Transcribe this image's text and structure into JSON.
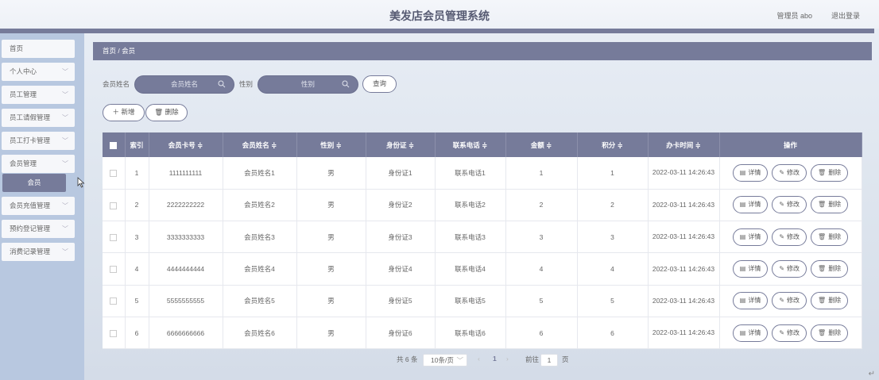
{
  "header": {
    "title": "美发店会员管理系统",
    "user": "管理员 abo",
    "logout": "退出登录"
  },
  "sidebar": {
    "items": [
      {
        "label": "首页",
        "has_arrow": false
      },
      {
        "label": "个人中心",
        "has_arrow": true
      },
      {
        "label": "员工管理",
        "has_arrow": true
      },
      {
        "label": "员工请假管理",
        "has_arrow": true
      },
      {
        "label": "员工打卡管理",
        "has_arrow": true
      },
      {
        "label": "会员管理",
        "has_arrow": true
      },
      {
        "label": "会员充值管理",
        "has_arrow": true
      },
      {
        "label": "预约登记管理",
        "has_arrow": true
      },
      {
        "label": "消费记录管理",
        "has_arrow": true
      }
    ],
    "active_sub": "会员"
  },
  "breadcrumb": "首页 / 会员",
  "search": {
    "name_label": "会员姓名",
    "name_placeholder": "会员姓名",
    "gender_label": "性别",
    "gender_placeholder": "性别",
    "query_button": "查询"
  },
  "actions": {
    "add": "新增",
    "delete": "删除"
  },
  "table": {
    "columns": [
      "索引",
      "会员卡号 ≑",
      "会员姓名 ≑",
      "性别 ≑",
      "身份证 ≑",
      "联系电话 ≑",
      "金额 ≑",
      "积分 ≑",
      "办卡时间 ≑",
      "操作"
    ],
    "rows": [
      {
        "index": "1",
        "card": "1111111111",
        "name": "会员姓名1",
        "gender": "男",
        "id_card": "身份证1",
        "phone": "联系电话1",
        "amount": "1",
        "points": "1",
        "time": "2022-03-11 14:26:43"
      },
      {
        "index": "2",
        "card": "2222222222",
        "name": "会员姓名2",
        "gender": "男",
        "id_card": "身份证2",
        "phone": "联系电话2",
        "amount": "2",
        "points": "2",
        "time": "2022-03-11 14:26:43"
      },
      {
        "index": "3",
        "card": "3333333333",
        "name": "会员姓名3",
        "gender": "男",
        "id_card": "身份证3",
        "phone": "联系电话3",
        "amount": "3",
        "points": "3",
        "time": "2022-03-11 14:26:43"
      },
      {
        "index": "4",
        "card": "4444444444",
        "name": "会员姓名4",
        "gender": "男",
        "id_card": "身份证4",
        "phone": "联系电话4",
        "amount": "4",
        "points": "4",
        "time": "2022-03-11 14:26:43"
      },
      {
        "index": "5",
        "card": "5555555555",
        "name": "会员姓名5",
        "gender": "男",
        "id_card": "身份证5",
        "phone": "联系电话5",
        "amount": "5",
        "points": "5",
        "time": "2022-03-11 14:26:43"
      },
      {
        "index": "6",
        "card": "6666666666",
        "name": "会员姓名6",
        "gender": "男",
        "id_card": "身份证6",
        "phone": "联系电话6",
        "amount": "6",
        "points": "6",
        "time": "2022-03-11 14:26:43"
      }
    ],
    "row_buttons": {
      "detail": "详情",
      "edit": "修改",
      "delete": "删除"
    }
  },
  "pagination": {
    "total": "共 6 条",
    "page_size": "10条/页",
    "current_page": "1",
    "goto_label": "前往",
    "goto_value": "1",
    "page_suffix": "页"
  },
  "colors": {
    "accent": "#767b9a",
    "sidebar_bg": "#b8c8e0",
    "header_bg": "#eef1f7"
  }
}
